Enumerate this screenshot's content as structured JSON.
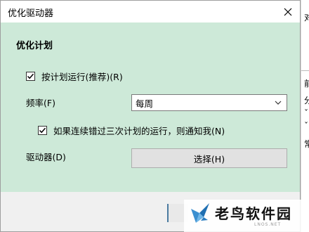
{
  "window": {
    "title": "优化驱动器",
    "close_glyph": "✕"
  },
  "schedule": {
    "heading": "优化计划",
    "run_on_schedule_label": "按计划运行(推荐)(R)",
    "run_on_schedule_checked": true,
    "frequency_label": "频率(F)",
    "frequency_value": "每周",
    "notify_label": "如果连续错过三次计划的运行，则通知我(N)",
    "notify_checked": true,
    "drives_label": "驱动器(D)",
    "choose_button": "选择(H)"
  },
  "background": {
    "chars": [
      "对",
      "前",
      "分",
      "ˇ",
      "ˇ",
      "常"
    ]
  },
  "watermark": {
    "title": "老鸟软件园",
    "url": "LNOS.NET"
  },
  "colors": {
    "content_bg": "#cde9d8",
    "dialog_bg": "#f0f0f0",
    "titlebar_bg": "#ffffff",
    "button_bg": "#e1e1e1",
    "accent": "#4a7ba0"
  }
}
